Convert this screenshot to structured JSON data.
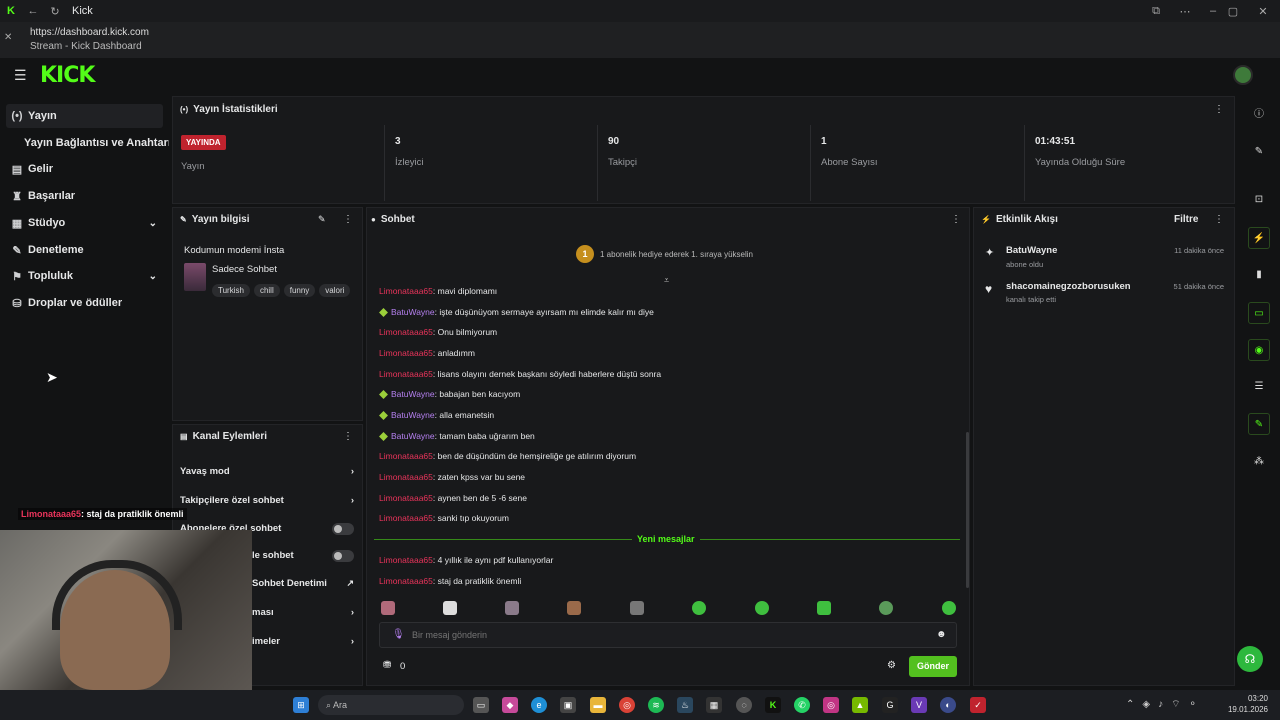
{
  "browser": {
    "tab_title": "Kick",
    "url": "https://dashboard.kick.com",
    "page_title": "Stream - Kick Dashboard"
  },
  "brand": {
    "logo": "KICK",
    "accent": "#53fc18"
  },
  "sidebar": {
    "items": [
      {
        "label": "Yayın",
        "icon": "broadcast-icon"
      },
      {
        "label": "Yayın Bağlantısı ve Anahtarı",
        "icon": ""
      },
      {
        "label": "Gelir",
        "icon": "dollar-icon"
      },
      {
        "label": "Başarılar",
        "icon": "trophy-icon"
      },
      {
        "label": "Stüdyo",
        "icon": "studio-icon"
      },
      {
        "label": "Denetleme",
        "icon": "wrench-icon"
      },
      {
        "label": "Topluluk",
        "icon": "community-icon"
      },
      {
        "label": "Droplar ve ödüller",
        "icon": "drops-icon"
      }
    ]
  },
  "stats": {
    "title": "Yayın İstatistikleri",
    "live_badge": "YAYINDA",
    "live_label": "Yayın",
    "viewers_value": "3",
    "viewers_label": "İzleyici",
    "followers_value": "90",
    "followers_label": "Takipçi",
    "subs_value": "1",
    "subs_label": "Abone Sayısı",
    "uptime_value": "01:43:51",
    "uptime_label": "Yayında Olduğu Süre"
  },
  "stream_info": {
    "title": "Yayın bilgisi",
    "stream_title": "Kodumun modemi İnsta",
    "category": "Sadece Sohbet",
    "tags": [
      "Turkish",
      "chill",
      "funny",
      "valori"
    ]
  },
  "channel_actions": {
    "title": "Kanal Eylemleri",
    "items": [
      "Yavaş mod",
      "Takipçilere özel sohbet",
      "Abonelere özel sohbet",
      "le sohbet",
      "Sohbet Denetimi",
      "ması",
      "imeler"
    ]
  },
  "chat": {
    "title": "Sohbet",
    "pinned": "1 abonelik hediye ederek 1. sıraya yükselin",
    "pinned_number": "1",
    "messages": [
      {
        "user": "Limonataaa65",
        "text": ": mavi diplomamı"
      },
      {
        "user": "BatuWayne",
        "text": ": işte düşünüyom sermaye ayırsam mı elimde kalır mı diye"
      },
      {
        "user": "Limonataaa65",
        "text": ": Onu bilmiyorum"
      },
      {
        "user": "Limonataaa65",
        "text": ": anladımm"
      },
      {
        "user": "Limonataaa65",
        "text": ": lisans olayını dernek başkanı söyledi haberlere düştü sonra"
      },
      {
        "user": "BatuWayne",
        "text": ": babajan ben kacıyom"
      },
      {
        "user": "BatuWayne",
        "text": ": alla emanetsin"
      },
      {
        "user": "BatuWayne",
        "text": ": tamam baba uğrarım ben"
      },
      {
        "user": "Limonataaa65",
        "text": ": ben de düşündüm de hemşireliğe ge atılırım diyorum"
      },
      {
        "user": "Limonataaa65",
        "text": ": zaten kpss var bu sene"
      },
      {
        "user": "Limonataaa65",
        "text": ": aynen ben de 5 -6 sene"
      },
      {
        "user": "Limonataaa65",
        "text": ": sanki tıp okuyorum"
      },
      {
        "user": "Limonataaa65",
        "text": ": 4 yıllık ile aynı pdf kullanıyorlar"
      },
      {
        "user": "Limonataaa65",
        "text": ": staj da pratiklik önemli"
      }
    ],
    "new_messages": "Yeni mesajlar",
    "input_placeholder": "Bir mesaj gönderin",
    "points": "0",
    "send_label": "Gönder"
  },
  "activity": {
    "title": "Etkinlik Akışı",
    "filter": "Filtre",
    "events": [
      {
        "user": "BatuWayne",
        "action": "abone oldu",
        "time": "11 dakika önce"
      },
      {
        "user": "shacomainegzozborusuken",
        "action": "kanalı takip etti",
        "time": "51 dakika önce"
      }
    ]
  },
  "overlay": {
    "user": "Limonataaa65",
    "text": "staj da pratiklik önemli"
  },
  "taskbar": {
    "search": "Ara",
    "time": "03:20",
    "date": "19.01.2026"
  }
}
